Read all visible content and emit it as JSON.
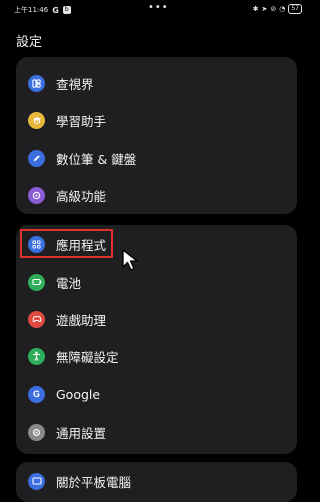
{
  "status_bar": {
    "time": "上午11:46",
    "google_badge": "G",
    "app_badge": "b",
    "dots": "•••",
    "battery": "57"
  },
  "page_title": "設定",
  "cards": [
    {
      "items": [
        {
          "label": "查視界",
          "icon": "split-screen-icon",
          "color": "#3b6fe0"
        },
        {
          "label": "學習助手",
          "icon": "graduation-cap-icon",
          "color": "#e8b83a"
        },
        {
          "label": "數位筆 & 鍵盤",
          "icon": "pen-icon",
          "color": "#3b6fe0"
        },
        {
          "label": "高級功能",
          "icon": "star-icon",
          "color": "#8a5cd6"
        }
      ]
    },
    {
      "items": [
        {
          "label": "應用程式",
          "icon": "apps-grid-icon",
          "color": "#3b6fe0"
        },
        {
          "label": "電池",
          "icon": "battery-icon",
          "color": "#2fae5a"
        },
        {
          "label": "遊戲助理",
          "icon": "gamepad-icon",
          "color": "#e0473f"
        },
        {
          "label": "無障礙設定",
          "icon": "accessibility-icon",
          "color": "#2fae5a"
        },
        {
          "label": "Google",
          "icon": "google-icon",
          "color": "#3b6fe0"
        },
        {
          "label": "通用設置",
          "icon": "gear-icon",
          "color": "#8a8a8a"
        }
      ]
    },
    {
      "items": [
        {
          "label": "關於平板電腦",
          "icon": "tablet-icon",
          "color": "#3b6fe0"
        }
      ]
    }
  ]
}
